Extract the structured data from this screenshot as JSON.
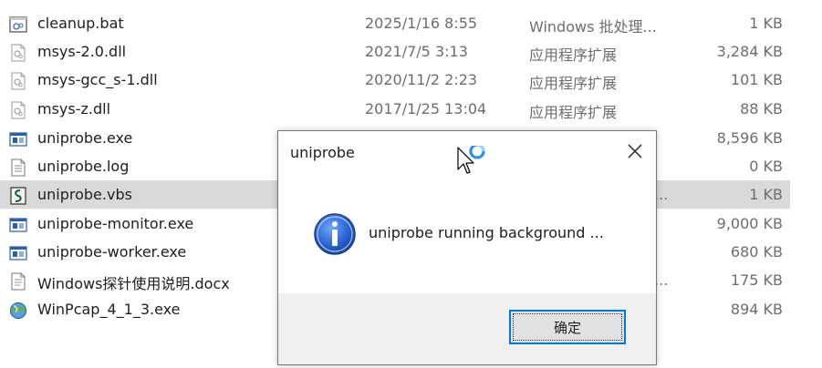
{
  "files": [
    {
      "name": "cleanup.bat",
      "date": "2025/1/16 8:55",
      "type": "Windows 批处理...",
      "size": "1 KB",
      "icon": "batch-file-icon",
      "selected": false
    },
    {
      "name": "msys-2.0.dll",
      "date": "2021/7/5 3:13",
      "type": "应用程序扩展",
      "size": "3,284 KB",
      "icon": "dll-file-icon",
      "selected": false
    },
    {
      "name": "msys-gcc_s-1.dll",
      "date": "2020/11/2 2:23",
      "type": "应用程序扩展",
      "size": "101 KB",
      "icon": "dll-file-icon",
      "selected": false
    },
    {
      "name": "msys-z.dll",
      "date": "2017/1/25 13:04",
      "type": "应用程序扩展",
      "size": "88 KB",
      "icon": "dll-file-icon",
      "selected": false
    },
    {
      "name": "uniprobe.exe",
      "date": "",
      "type": "",
      "size": "8,596 KB",
      "icon": "exe-file-icon",
      "selected": false
    },
    {
      "name": "uniprobe.log",
      "date": "",
      "type": "",
      "size": "0 KB",
      "icon": "text-file-icon",
      "selected": false
    },
    {
      "name": "uniprobe.vbs",
      "date": "",
      "type": "...",
      "size": "1 KB",
      "icon": "vbs-script-icon",
      "selected": true
    },
    {
      "name": "uniprobe-monitor.exe",
      "date": "",
      "type": "",
      "size": "9,000 KB",
      "icon": "exe-file-icon",
      "selected": false
    },
    {
      "name": "uniprobe-worker.exe",
      "date": "",
      "type": "",
      "size": "680 KB",
      "icon": "exe-file-icon",
      "selected": false
    },
    {
      "name": "Windows探针使用说明.docx",
      "date": "",
      "type": "...",
      "size": "175 KB",
      "icon": "docx-file-icon",
      "selected": false
    },
    {
      "name": "WinPcap_4_1_3.exe",
      "date": "",
      "type": "",
      "size": "894 KB",
      "icon": "installer-exe-icon",
      "selected": false
    }
  ],
  "dialog": {
    "title": "uniprobe",
    "message": "uniprobe running background ...",
    "ok_label": "确定",
    "close_icon": "close-icon",
    "info_icon": "info-icon"
  },
  "cursor": {
    "icon": "busy-pointer-icon"
  },
  "colors": {
    "accent": "#0078d7",
    "selected_row": "#d9d9d9",
    "secondary_text": "#6d6d6d",
    "footer_bg": "#f0f0f0",
    "info_blue": "#1f5fc7"
  }
}
